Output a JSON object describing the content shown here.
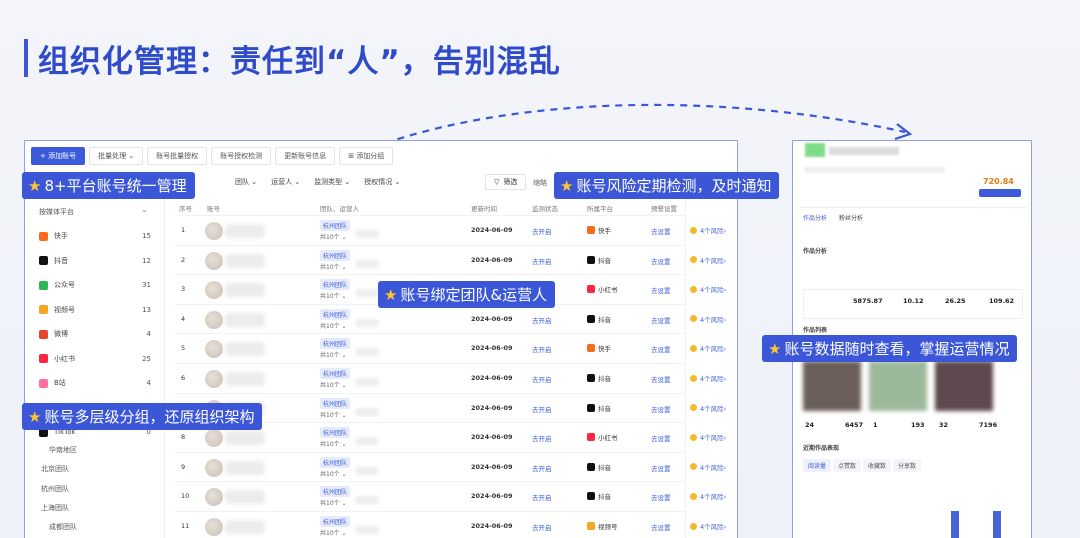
{
  "heading": "组织化管理：责任到“人”，告别混乱",
  "toolbar": {
    "add": "+ 添加账号",
    "batch": "批量处理 ⌄",
    "batch_auth": "账号批量授权",
    "auth_check": "账号授权检测",
    "update_info": "更新账号信息",
    "add_group": "⊞ 添加分组"
  },
  "filters": {
    "team": "团队 ⌄",
    "operator": "运营人 ⌄",
    "monitor_type": "监测类型 ⌄",
    "auth_status": "授权情况 ⌄",
    "filter_btn": "筛选",
    "more": "缩略"
  },
  "sidebar": {
    "title": "按媒体平台",
    "platforms": [
      {
        "name": "快手",
        "count": "15",
        "color": "#f76b1c"
      },
      {
        "name": "抖音",
        "count": "12",
        "color": "#111111"
      },
      {
        "name": "公众号",
        "count": "31",
        "color": "#2fb84f"
      },
      {
        "name": "视频号",
        "count": "13",
        "color": "#f5a623"
      },
      {
        "name": "微博",
        "count": "4",
        "color": "#e6452b"
      },
      {
        "name": "小红书",
        "count": "25",
        "color": "#ff2442"
      },
      {
        "name": "B站",
        "count": "4",
        "color": "#ff6fa0"
      },
      {
        "name": "今日头条",
        "count": "8",
        "color": "#555555"
      },
      {
        "name": "TikTok",
        "count": "0",
        "color": "#111111"
      }
    ],
    "groups": [
      "华南地区",
      "北京团队",
      "杭州团队",
      "上海团队",
      "成都团队"
    ]
  },
  "table": {
    "headers": {
      "no": "序号",
      "account": "账号",
      "team": "团队、运营人",
      "update": "更新时间",
      "monitor": "监测状态",
      "platform": "所属平台",
      "alert": "预警设置"
    },
    "rows": [
      {
        "no": "1",
        "team": "杭州团队",
        "sub": "共10个 ⌄",
        "date": "2024-06-09",
        "open": "去开启",
        "platform": "快手",
        "pcolor": "#f76b1c",
        "set": "去设置",
        "risk": "4个风险›"
      },
      {
        "no": "2",
        "team": "杭州团队",
        "sub": "共10个 ⌄",
        "date": "2024-06-09",
        "open": "去开启",
        "platform": "抖音",
        "pcolor": "#111111",
        "set": "去设置",
        "risk": "4个风险›"
      },
      {
        "no": "3",
        "team": "杭州团队",
        "sub": "共10个 ⌄",
        "date": "2024-06-09",
        "open": "去开启",
        "platform": "小红书",
        "pcolor": "#ff2442",
        "set": "去设置",
        "risk": "4个风险›"
      },
      {
        "no": "4",
        "team": "杭州团队",
        "sub": "共10个 ⌄",
        "date": "2024-06-09",
        "open": "去开启",
        "platform": "抖音",
        "pcolor": "#111111",
        "set": "去设置",
        "risk": "4个风险›"
      },
      {
        "no": "5",
        "team": "杭州团队",
        "sub": "共10个 ⌄",
        "date": "2024-06-09",
        "open": "去开启",
        "platform": "快手",
        "pcolor": "#f76b1c",
        "set": "去设置",
        "risk": "4个风险›"
      },
      {
        "no": "6",
        "team": "杭州团队",
        "sub": "共10个 ⌄",
        "date": "2024-06-09",
        "open": "去开启",
        "platform": "抖音",
        "pcolor": "#111111",
        "set": "去设置",
        "risk": "4个风险›"
      },
      {
        "no": "7",
        "team": "杭州团队",
        "sub": "共10个 ⌄",
        "date": "2024-06-09",
        "open": "去开启",
        "platform": "抖音",
        "pcolor": "#111111",
        "set": "去设置",
        "risk": "4个风险›"
      },
      {
        "no": "8",
        "team": "杭州团队",
        "sub": "共10个 ⌄",
        "date": "2024-06-09",
        "open": "去开启",
        "platform": "小红书",
        "pcolor": "#ff2442",
        "set": "去设置",
        "risk": "4个风险›"
      },
      {
        "no": "9",
        "team": "杭州团队",
        "sub": "共10个 ⌄",
        "date": "2024-06-09",
        "open": "去开启",
        "platform": "抖音",
        "pcolor": "#111111",
        "set": "去设置",
        "risk": "4个风险›"
      },
      {
        "no": "10",
        "team": "杭州团队",
        "sub": "共10个 ⌄",
        "date": "2024-06-09",
        "open": "去开启",
        "platform": "抖音",
        "pcolor": "#111111",
        "set": "去设置",
        "risk": "4个风险›"
      },
      {
        "no": "11",
        "team": "杭州团队",
        "sub": "共10个 ⌄",
        "date": "2024-06-09",
        "open": "去开启",
        "platform": "视频号",
        "pcolor": "#f5a623",
        "set": "去设置",
        "risk": "4个风险›"
      }
    ]
  },
  "right_panel": {
    "price": "720.84",
    "tab1": "作品分析",
    "tab2": "粉丝分析",
    "section1": "作品分析",
    "section2": "作品列表",
    "stats": [
      "5875.87",
      "10.12",
      "26.25",
      "109.62"
    ],
    "metrics": [
      {
        "a": "24",
        "b": "6457"
      },
      {
        "a": "1",
        "b": "193"
      },
      {
        "a": "32",
        "b": "7196"
      }
    ],
    "section3": "近期作品表现",
    "tabs": [
      "阅读量",
      "点赞数",
      "收藏数",
      "分享数"
    ]
  },
  "callouts": {
    "c1": "8+平台账号统一管理",
    "c2": "账号风险定期检测，及时通知",
    "c3": "账号绑定团队&运营人",
    "c4": "账号数据随时查看，掌握运营情况",
    "c5": "账号多层级分组，还原组织架构"
  },
  "colors": {
    "accent": "#3b57d8",
    "star": "#ffc52e"
  }
}
